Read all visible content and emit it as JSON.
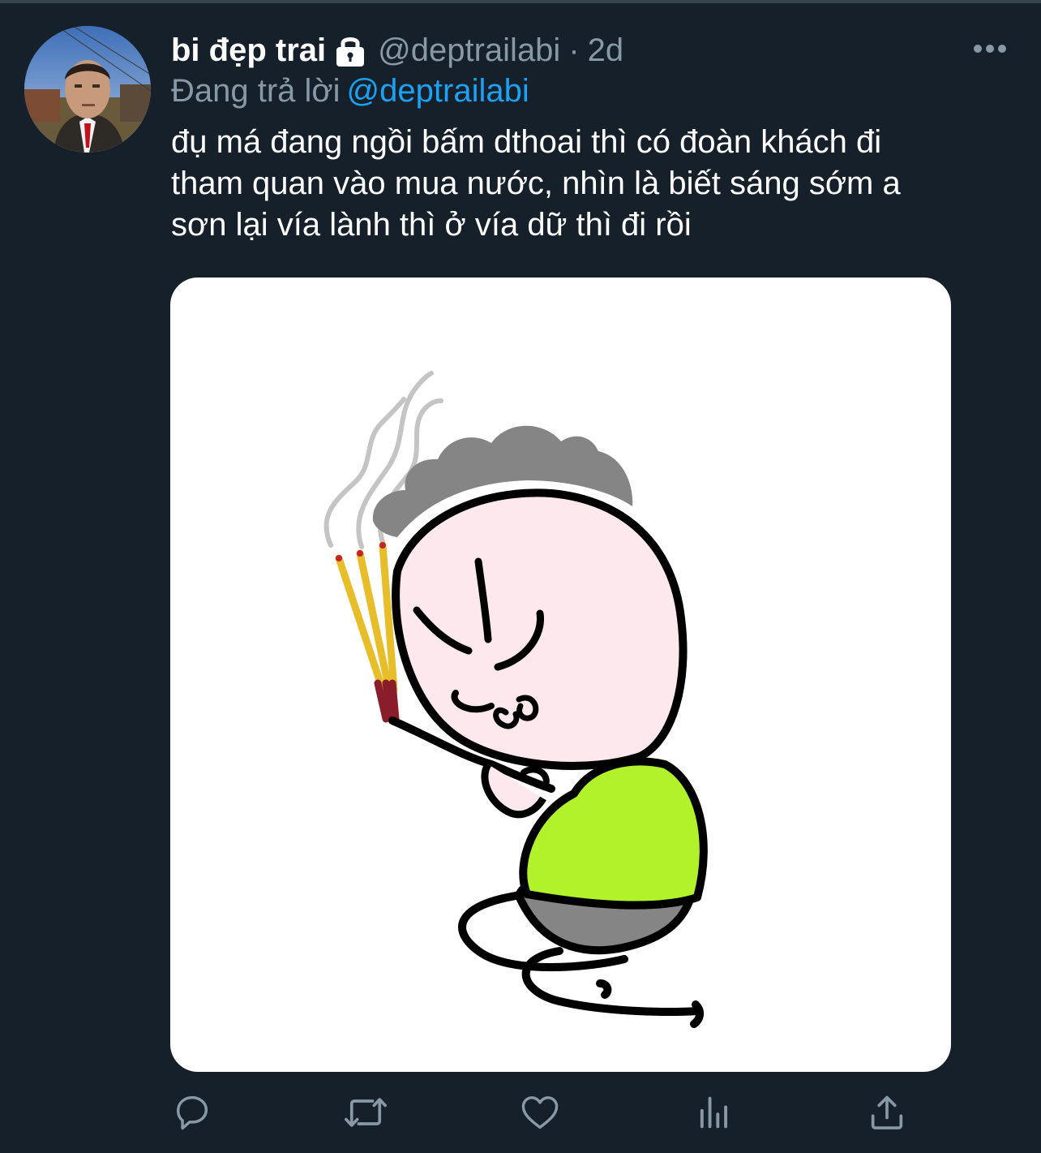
{
  "tweet": {
    "display_name": "bi đẹp trai",
    "protected_icon": "lock-icon",
    "handle": "@deptrailabi",
    "separator": "·",
    "timestamp": "2d",
    "reply_prefix": "Đang trả lời",
    "reply_to": "@deptrailabi",
    "text": "đụ má đang ngồi bấm dthoai thì có đoàn khách đi\ntham quan vào mua nước, nhìn là biết sáng sớm a\nsơn lại vía lành thì ở vía dữ thì đi rồi",
    "more_icon": "more-horizontal-icon"
  },
  "media": {
    "type": "illustration"
  },
  "actions": [
    {
      "icon": "reply-icon"
    },
    {
      "icon": "retweet-icon"
    },
    {
      "icon": "like-icon"
    },
    {
      "icon": "analytics-icon"
    },
    {
      "icon": "share-icon"
    }
  ],
  "colors": {
    "background": "#15202b",
    "primary_text": "#ffffff",
    "secondary_text": "#8899a6",
    "accent": "#1da1f2",
    "shirt": "#b2f22a",
    "hair": "#868686"
  }
}
